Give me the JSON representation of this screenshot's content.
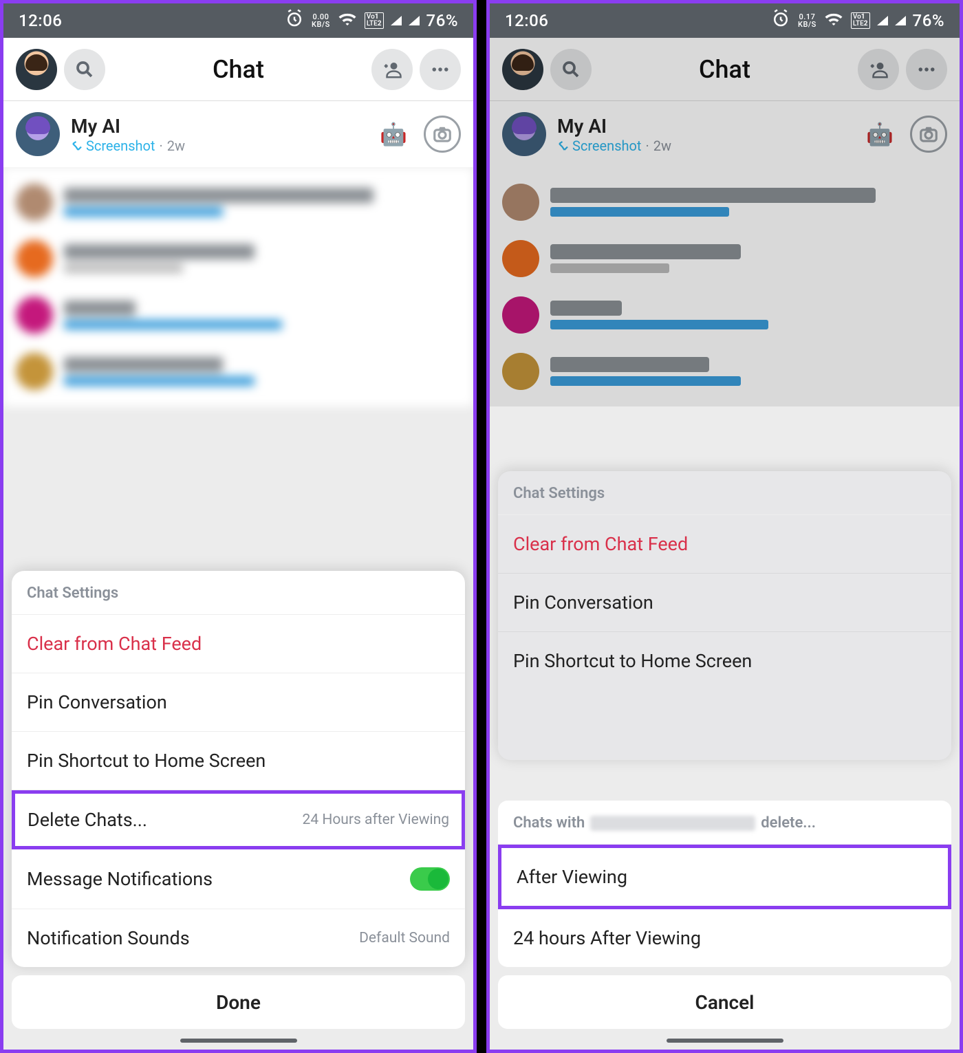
{
  "status": {
    "time": "12:06",
    "data1": {
      "top": "0.00",
      "bot": "KB/S"
    },
    "data2": {
      "top": "0.17",
      "bot": "KB/S"
    },
    "lte1": "Vo 1 LTE 2",
    "battery": "76%"
  },
  "header": {
    "title": "Chat"
  },
  "myai": {
    "name": "My AI",
    "action": "Screenshot",
    "time": "2w"
  },
  "sheet1": {
    "title": "Chat Settings",
    "clear": "Clear from Chat Feed",
    "pin_convo": "Pin Conversation",
    "pin_shortcut": "Pin Shortcut to Home Screen",
    "delete_chats": "Delete Chats...",
    "delete_chats_sub": "24 Hours after Viewing",
    "msg_notif": "Message Notifications",
    "notif_sounds": "Notification Sounds",
    "notif_sounds_sub": "Default Sound",
    "done": "Done"
  },
  "sheet2": {
    "title": "Chat Settings",
    "clear": "Clear from Chat Feed",
    "pin_convo": "Pin Conversation",
    "pin_shortcut": "Pin Shortcut to Home Screen",
    "chats_with_pre": "Chats with",
    "chats_with_post": "delete...",
    "opt1": "After Viewing",
    "opt2": "24 hours After Viewing",
    "cancel": "Cancel"
  }
}
